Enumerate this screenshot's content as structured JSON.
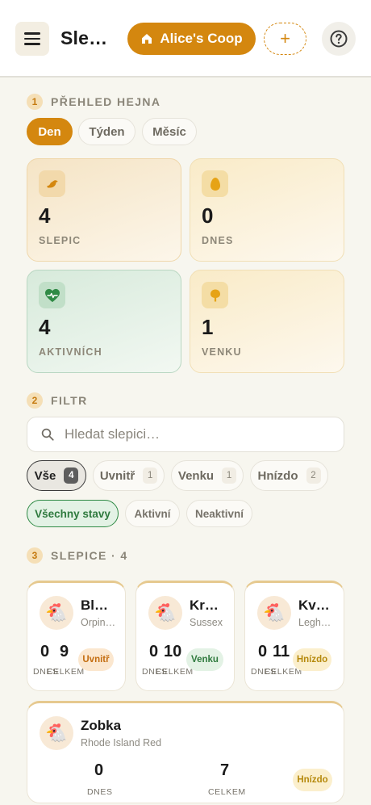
{
  "header": {
    "app_title": "Sle…",
    "coop_label": "Alice's Coop",
    "add_label": "+"
  },
  "overview": {
    "num": "1",
    "title": "PŘEHLED HEJNA",
    "periods": [
      "Den",
      "Týden",
      "Měsíc"
    ],
    "stats": [
      {
        "value": "4",
        "label": "SLEPIC"
      },
      {
        "value": "0",
        "label": "DNES"
      },
      {
        "value": "4",
        "label": "AKTIVNÍCH"
      },
      {
        "value": "1",
        "label": "VENKU"
      }
    ]
  },
  "filter": {
    "num": "2",
    "title": "FILTR",
    "search_placeholder": "Hledat slepici…",
    "locations": [
      {
        "label": "Vše",
        "count": "4"
      },
      {
        "label": "Uvnitř",
        "count": "1"
      },
      {
        "label": "Venku",
        "count": "1"
      },
      {
        "label": "Hnízdo",
        "count": "2"
      }
    ],
    "statuses": [
      "Všechny stavy",
      "Aktivní",
      "Neaktivní"
    ]
  },
  "hens_section": {
    "num": "3",
    "title": "SLEPICE · 4"
  },
  "hens": [
    {
      "name": "Bl…",
      "breed": "Orpin…",
      "today": "0",
      "total": "9",
      "today_label": "DNES",
      "total_label": "CELKEM",
      "badge": "Uvnitř"
    },
    {
      "name": "Kr…",
      "breed": "Sussex",
      "today": "0",
      "total": "10",
      "today_label": "DNES",
      "total_label": "CELKEM",
      "badge": "Venku"
    },
    {
      "name": "Kv…",
      "breed": "Legh…",
      "today": "0",
      "total": "11",
      "today_label": "DNES",
      "total_label": "CELKEM",
      "badge": "Hnízdo"
    },
    {
      "name": "Zobka",
      "breed": "Rhode Island Red",
      "today": "0",
      "total": "7",
      "today_label": "DNES",
      "total_label": "CELKEM",
      "badge": "Hnízdo"
    }
  ],
  "colors": {
    "accent": "#d4870f",
    "active_green": "#2f7a3e",
    "background": "#f7f6ef"
  },
  "icons": {
    "menu": "hamburger-icon",
    "coop": "home-icon",
    "help": "help-circle-icon",
    "search": "search-icon",
    "hen_avatar": "chicken-icon"
  }
}
